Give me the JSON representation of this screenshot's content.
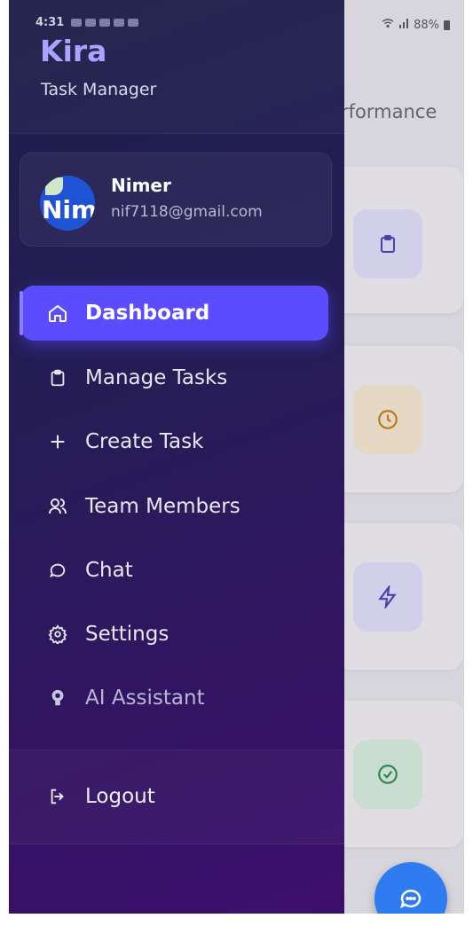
{
  "status_bar": {
    "time": "4:31",
    "battery": "88%"
  },
  "background_page": {
    "title_fragment": "rformance"
  },
  "drawer": {
    "brand": "Kira",
    "tagline": "Task Manager",
    "profile": {
      "name": "Nimer",
      "email": "nif7118@gmail.com",
      "avatar_text": "Nim"
    },
    "menu": [
      {
        "label": "Dashboard",
        "icon": "home-icon",
        "active": true
      },
      {
        "label": "Manage Tasks",
        "icon": "clipboard-icon"
      },
      {
        "label": "Create Task",
        "icon": "plus-icon"
      },
      {
        "label": "Team Members",
        "icon": "users-icon"
      },
      {
        "label": "Chat",
        "icon": "chat-bubble-icon"
      },
      {
        "label": "Settings",
        "icon": "gear-icon"
      },
      {
        "label": "AI Assistant",
        "icon": "lightbulb-icon"
      }
    ],
    "logout_label": "Logout"
  },
  "colors": {
    "accent": "#5b4dff",
    "brand_text": "#a9a4ff",
    "fab": "#2f7cf0"
  }
}
